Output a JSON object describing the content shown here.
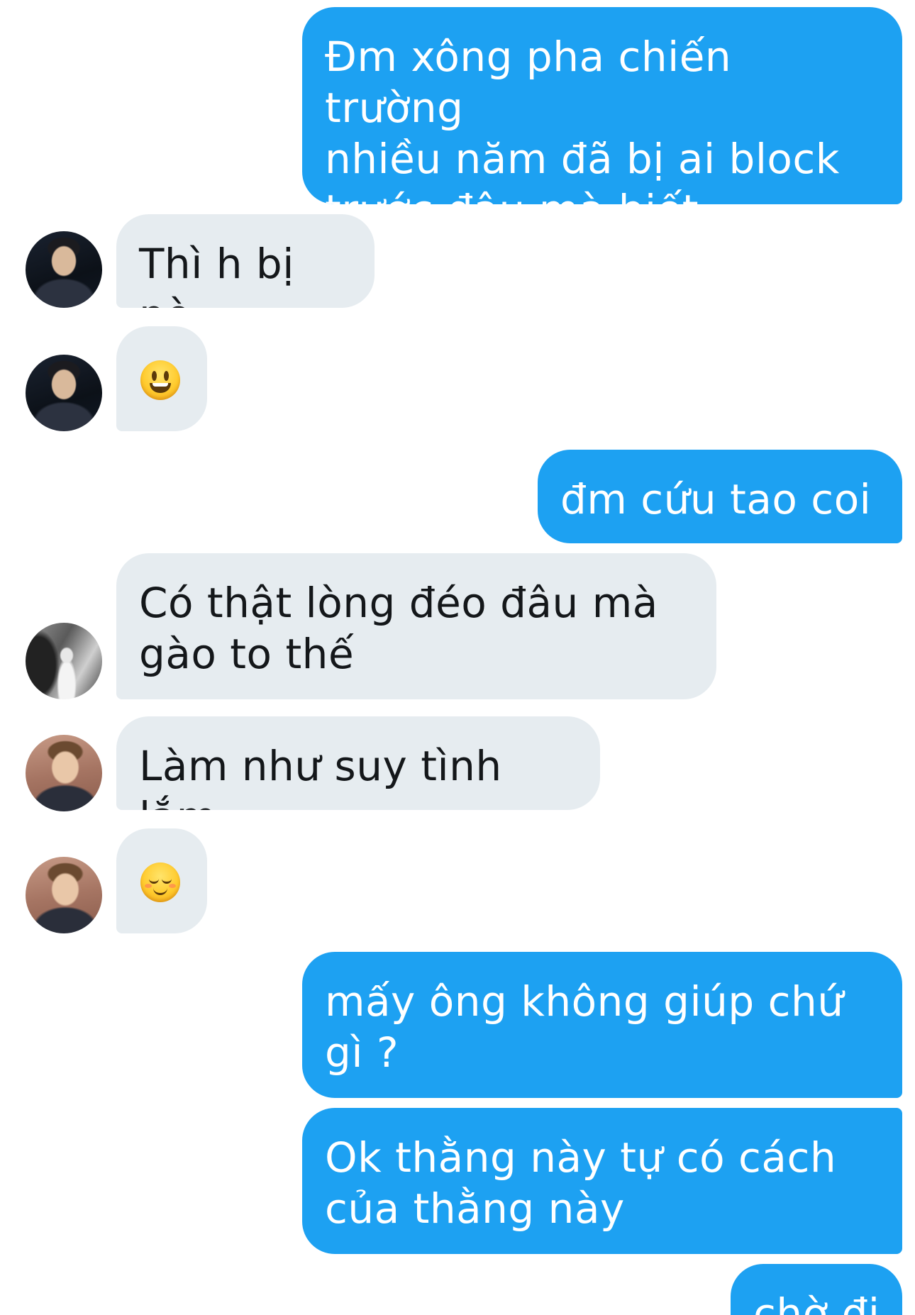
{
  "messages": [
    {
      "id": "m1",
      "direction": "outgoing",
      "text": "Đm xông pha chiến trường\nnhiều năm đã bị ai block\ntrước đâu mà biết"
    },
    {
      "id": "m2",
      "direction": "incoming",
      "avatar": "avatar-dark-suit",
      "text": "Thì h bị nè"
    },
    {
      "id": "m3",
      "direction": "incoming",
      "avatar": "avatar-dark-suit",
      "emoji": "grinning-face-emoji"
    },
    {
      "id": "m4",
      "direction": "outgoing",
      "text": "đm cứu tao coi"
    },
    {
      "id": "m5",
      "direction": "incoming",
      "avatar": "avatar-mono-photo",
      "text": "Có thật lòng đéo đâu mà\ngào to thế"
    },
    {
      "id": "m6",
      "direction": "incoming",
      "avatar": "avatar-warm-portrait",
      "text": "Làm như suy tình lắm"
    },
    {
      "id": "m7",
      "direction": "incoming",
      "avatar": "avatar-warm-portrait",
      "emoji": "relieved-face-emoji"
    },
    {
      "id": "m8",
      "direction": "outgoing",
      "text": "mấy ông không giúp chứ\ngì ?"
    },
    {
      "id": "m9",
      "direction": "outgoing",
      "text": "Ok thằng này tự có cách\ncủa thằng này"
    },
    {
      "id": "m10",
      "direction": "outgoing",
      "text": "chờ đi"
    }
  ],
  "colors": {
    "outgoing_bubble": "#1da1f2",
    "incoming_bubble": "#e6ecf0",
    "outgoing_text": "#ffffff",
    "incoming_text": "#14171a"
  }
}
